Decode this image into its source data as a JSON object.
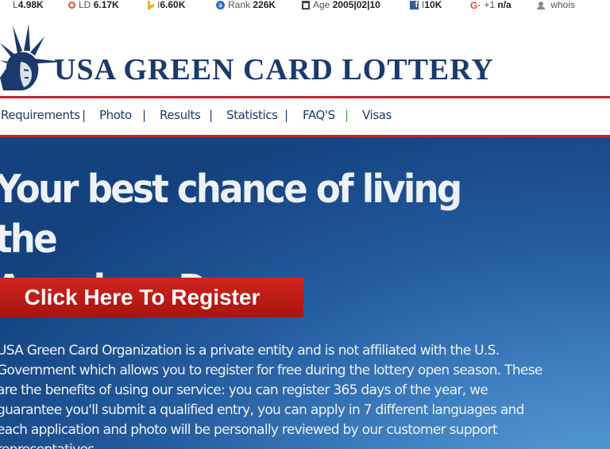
{
  "seo_toolbar": {
    "items": [
      {
        "prefix": "L",
        "value": "4.98K",
        "icon": "link-icon"
      },
      {
        "prefix": "LD",
        "value": "6.17K",
        "icon": "circle-icon"
      },
      {
        "prefix": "I",
        "value": "6.60K",
        "icon": "bing-icon"
      },
      {
        "prefix": "Rank",
        "value": "226K",
        "icon": "alexa-icon"
      },
      {
        "prefix": "Age",
        "value": "2005|02|10",
        "icon": "calendar-icon"
      },
      {
        "prefix": "I",
        "value": "10K",
        "icon": "facebook-icon"
      },
      {
        "prefix": "+1",
        "value": "n/a",
        "icon": "google-plus-icon"
      },
      {
        "prefix": "",
        "value": "whois",
        "icon": "user-icon"
      }
    ]
  },
  "header": {
    "title": "USA GREEN CARD LOTTERY",
    "logo_icon": "statue-of-liberty-icon"
  },
  "nav": {
    "items": [
      "Requirements",
      "Photo",
      "Results",
      "Statistics",
      "FAQ'S",
      "Visas"
    ],
    "separator": "|"
  },
  "hero": {
    "headline_line1": "Your best chance of living the",
    "headline_line2": "American Dream",
    "cta_label": "Click Here To Register",
    "blurb": "USA Green Card Organization is a private entity and is not affiliated with the U.S. Government which allows you to register for free during the lottery open season. These are the benefits of using our service: you can register 365 days of the year, we guarantee you'll submit a qualified entry, you can apply in 7 different languages and each application and photo will be personally reviewed by our customer support representatives."
  },
  "colors": {
    "brand_navy": "#1b3a6b",
    "accent_red": "#c1272d",
    "cta_red": "#c41e1a",
    "hero_blue": "#245c9f"
  }
}
